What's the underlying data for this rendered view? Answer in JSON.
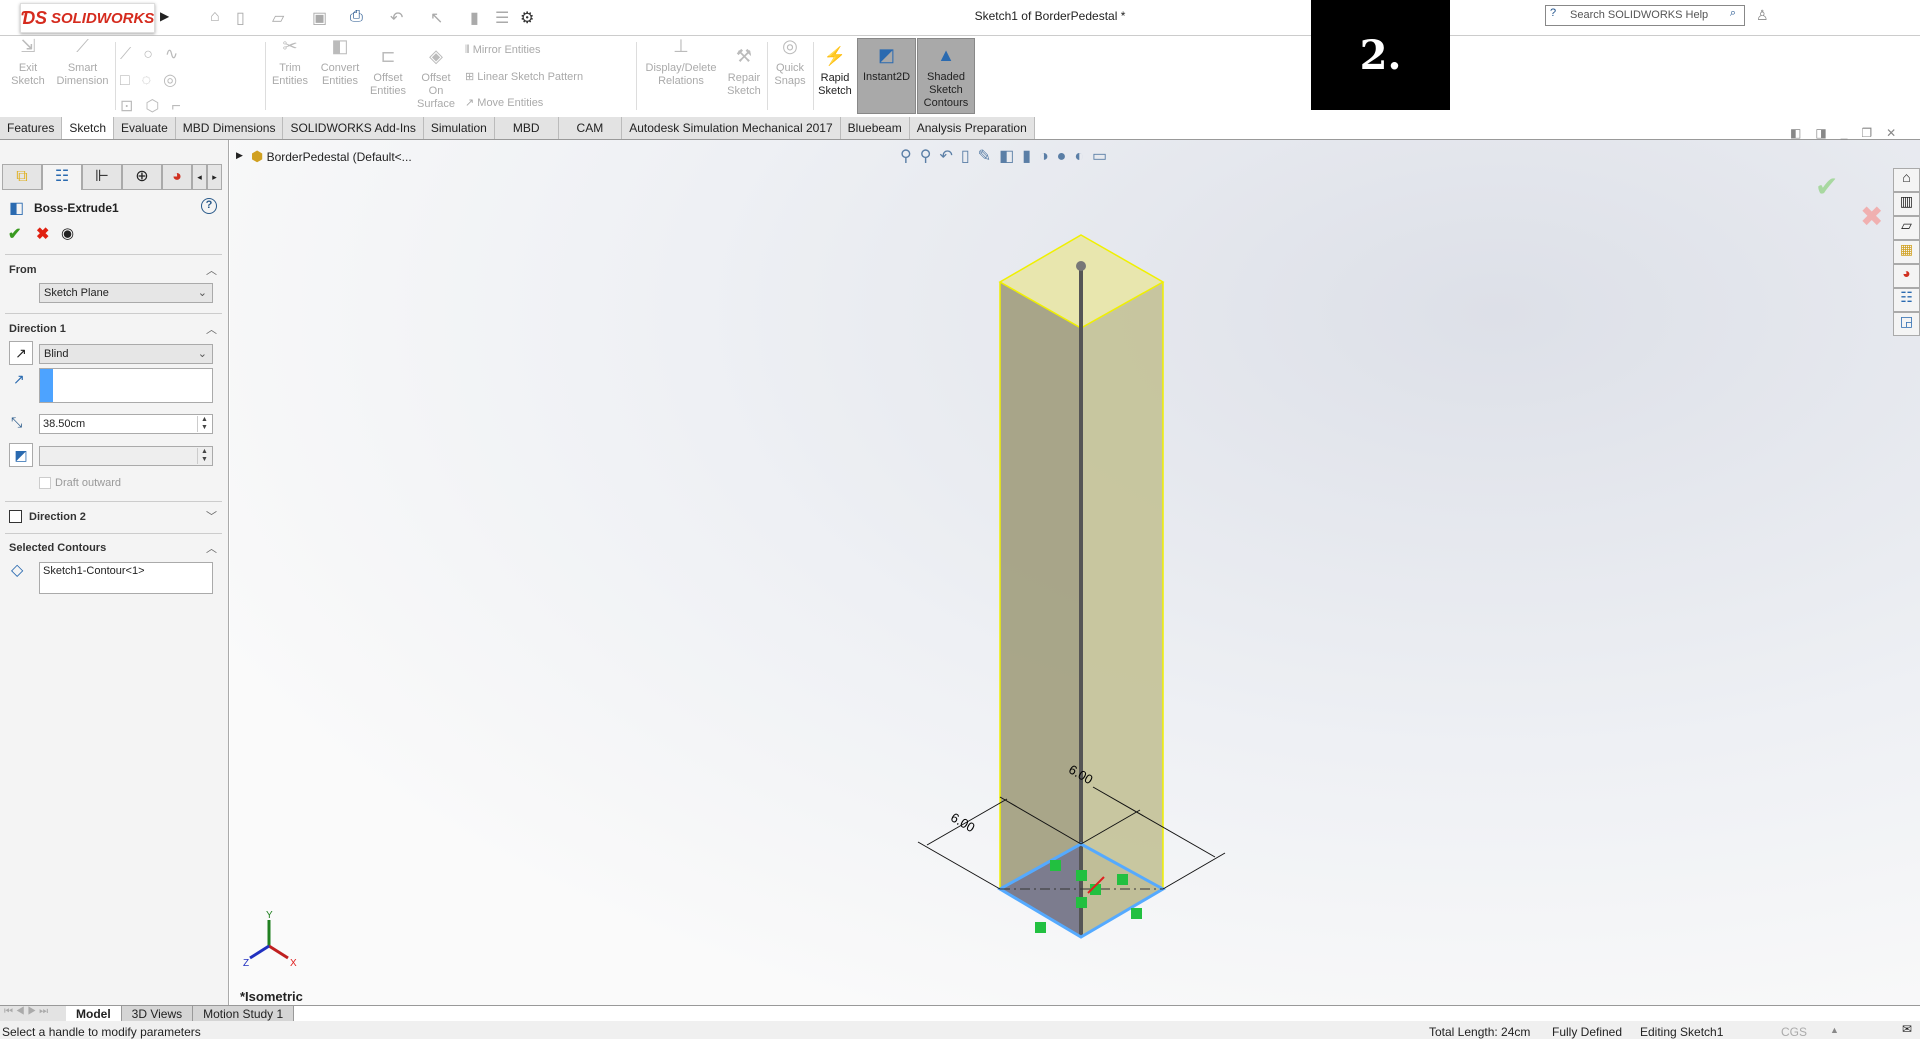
{
  "app": {
    "name": "SOLIDWORKS",
    "doc_title": "Sketch1 of BorderPedestal *",
    "badge": "2.",
    "search_placeholder": "Search SOLIDWORKS Help"
  },
  "ribbon": {
    "exit_sketch": "Exit Sketch",
    "smart_dimension": "Smart Dimension",
    "trim_entities": "Trim Entities",
    "convert_entities": "Convert Entities",
    "offset_entities": "Offset Entities",
    "offset_on_surface": "Offset On Surface",
    "mirror_entities": "Mirror Entities",
    "linear_sketch_pattern": "Linear Sketch Pattern",
    "move_entities": "Move Entities",
    "display_delete_relations": "Display/Delete Relations",
    "repair_sketch": "Repair Sketch",
    "quick_snaps": "Quick Snaps",
    "rapid_sketch": "Rapid Sketch",
    "instant2d": "Instant2D",
    "shaded_sketch_contours": "Shaded Sketch Contours"
  },
  "tabs": [
    "Features",
    "Sketch",
    "Evaluate",
    "MBD Dimensions",
    "SOLIDWORKS Add-Ins",
    "Simulation",
    "MBD",
    "CAM",
    "Autodesk Simulation Mechanical 2017",
    "Bluebeam",
    "Analysis Preparation"
  ],
  "panel": {
    "title": "Boss-Extrude1",
    "from_label": "From",
    "from_value": "Sketch Plane",
    "dir1_label": "Direction 1",
    "end_condition": "Blind",
    "depth": "38.50cm",
    "draft_outward": "Draft outward",
    "dir2_label": "Direction 2",
    "contours_label": "Selected Contours",
    "contour_value": "Sketch1-Contour<1>"
  },
  "view": {
    "tree_root": "BorderPedestal  (Default<...",
    "view_name": "*Isometric",
    "dim1": "6.00",
    "dim2": "6.00",
    "axis_x": "X",
    "axis_y": "Y",
    "axis_z": "Z"
  },
  "bottom_tabs": [
    "Model",
    "3D Views",
    "Motion Study 1"
  ],
  "status": {
    "message": "Select a handle to modify parameters",
    "total_length": "Total Length: 24cm",
    "defined": "Fully Defined",
    "editing": "Editing Sketch1",
    "units": "CGS"
  }
}
